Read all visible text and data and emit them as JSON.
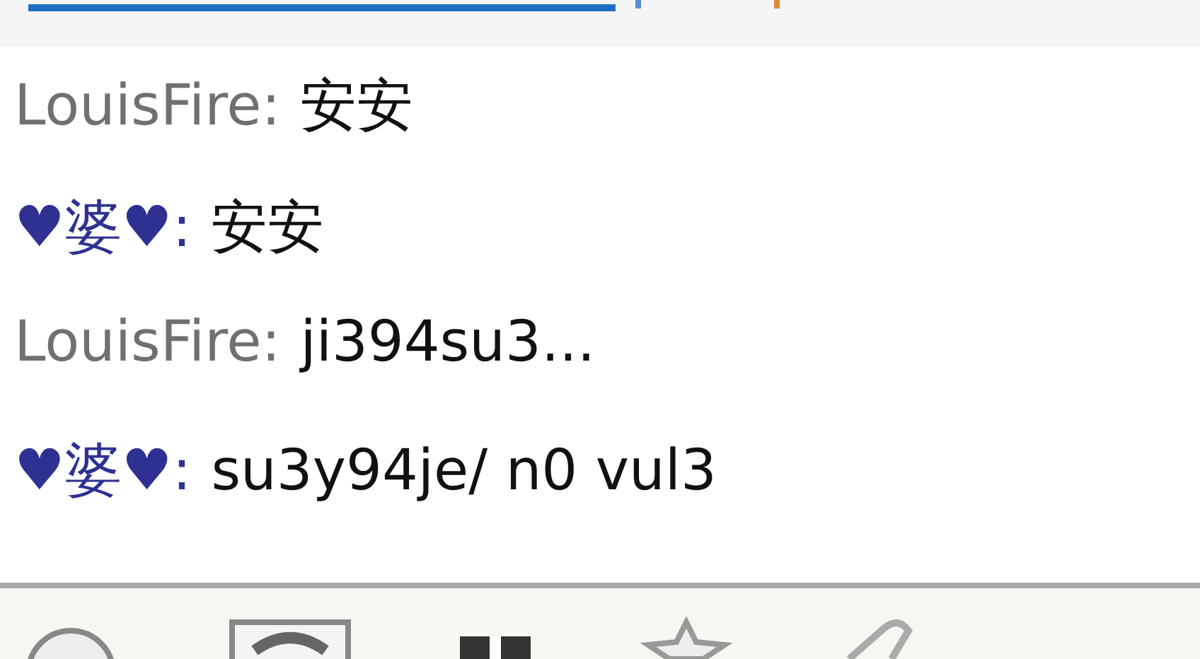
{
  "messages": [
    {
      "sender": "LouisFire:",
      "color": "#707070",
      "text": "安安"
    },
    {
      "sender": "♥婆♥:",
      "color": "#2e3192",
      "text": "安安"
    },
    {
      "sender": "LouisFire:",
      "color": "#707070",
      "text": "ji394su3..."
    },
    {
      "sender": "♥婆♥:",
      "color": "#2e3192",
      "text": "su3y94je/ n0 vul3"
    }
  ]
}
